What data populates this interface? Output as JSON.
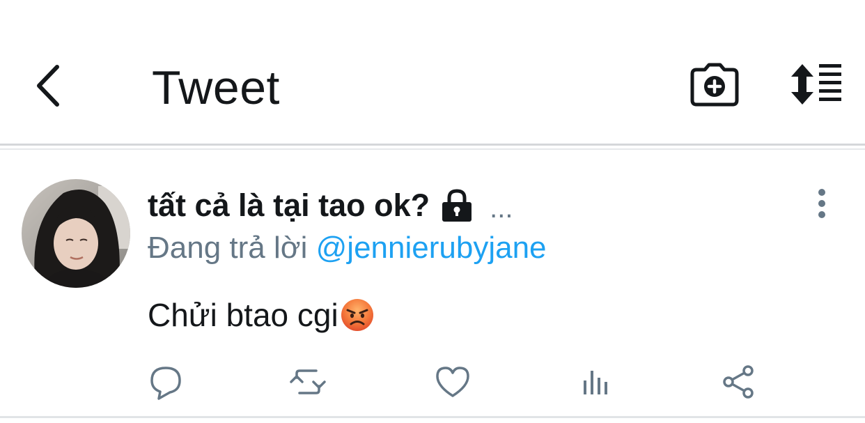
{
  "header": {
    "title": "Tweet",
    "back_icon": "chevron-left-icon",
    "camera_icon": "camera-plus-icon",
    "sort_icon": "sort-lines-icon"
  },
  "tweet": {
    "author_name": "tất cả là tại tao ok?",
    "lock_icon": "lock-icon",
    "truncation": "...",
    "reply_prefix": "Đang trả lời",
    "reply_handle": "@jennierubyjane",
    "text": "Chửi btao cgi",
    "emoji": "angry-face-emoji"
  },
  "actions": [
    "reply-icon",
    "retweet-icon",
    "like-icon",
    "analytics-icon",
    "share-icon"
  ],
  "colors": {
    "text": "#14171a",
    "secondary": "#657786",
    "link": "#1da1f2",
    "divider": "#d5d7da"
  }
}
